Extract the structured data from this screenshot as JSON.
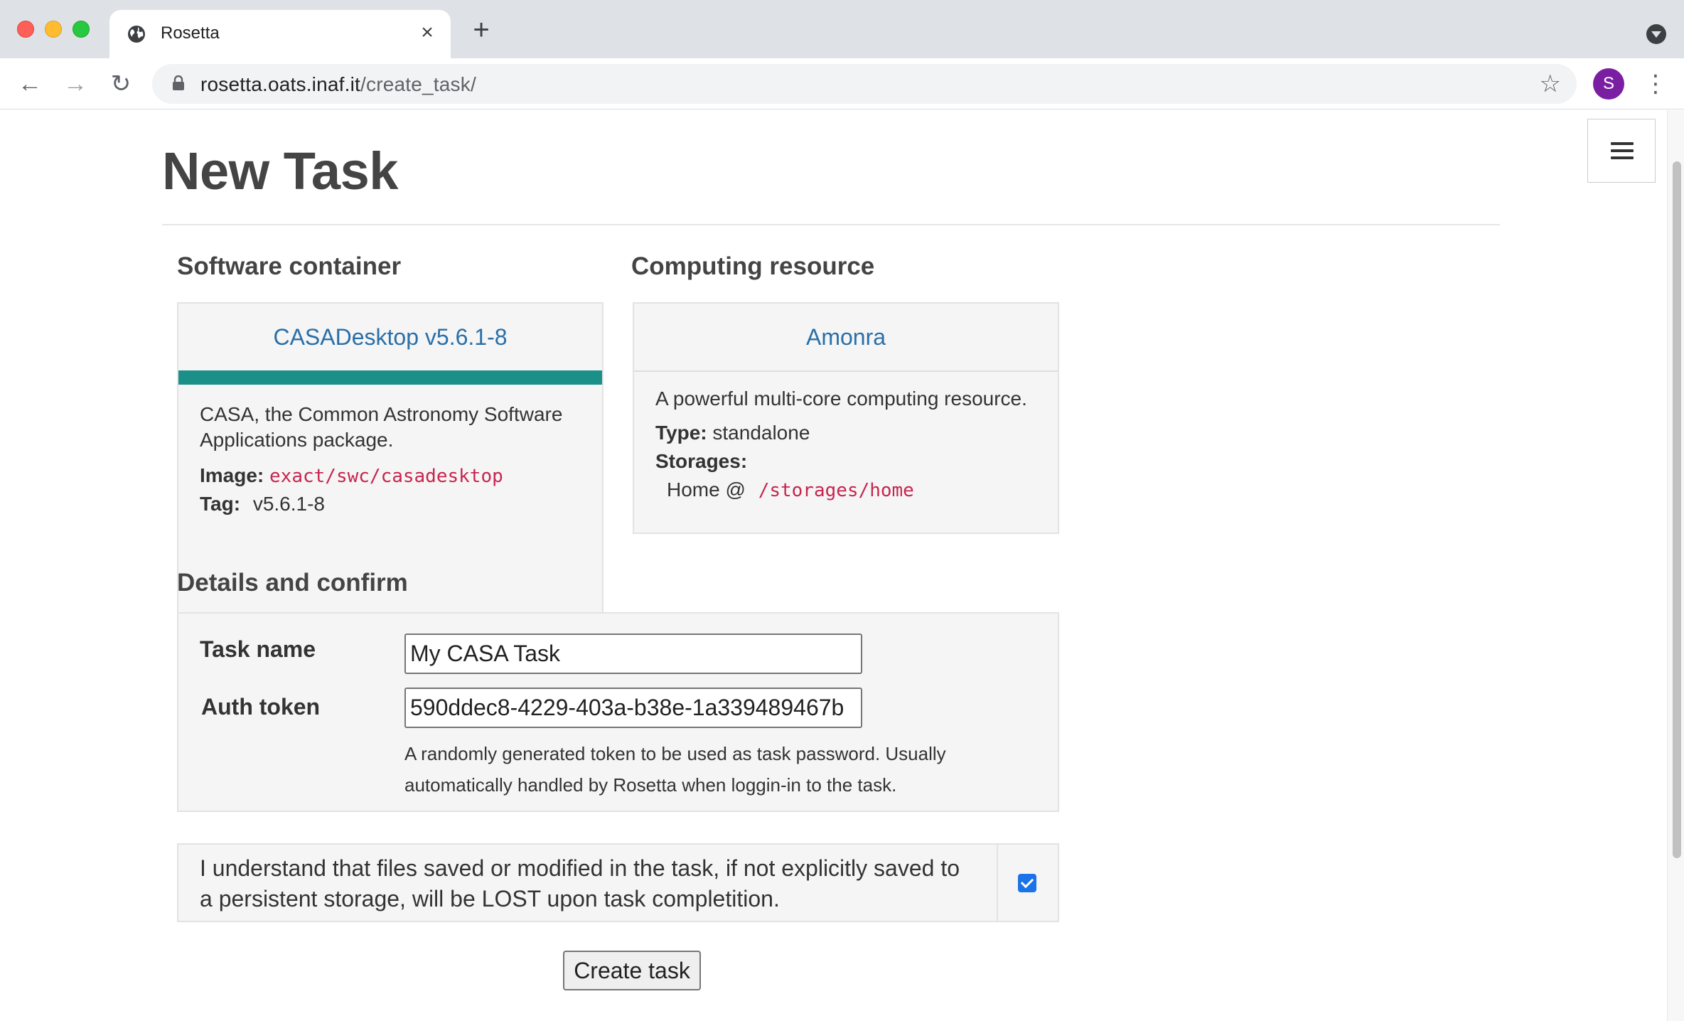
{
  "browser": {
    "tab_title": "Rosetta",
    "url_host": "rosetta.oats.inaf.it",
    "url_path": "/create_task/",
    "profile_initial": "S"
  },
  "page": {
    "title": "New Task"
  },
  "software": {
    "heading": "Software container",
    "name": "CASADesktop v5.6.1-8",
    "description": "CASA, the Common Astronomy Software Applications package.",
    "image_label": "Image:",
    "image_value": "exact/swc/casadesktop",
    "tag_label": "Tag:",
    "tag_value": "v5.6.1-8",
    "accent_color": "#1a9088"
  },
  "computing": {
    "heading": "Computing resource",
    "name": "Amonra",
    "description": "A powerful multi-core computing resource.",
    "type_label": "Type:",
    "type_value": "standalone",
    "storages_label": "Storages:",
    "storage_name": "Home @",
    "storage_path": "/storages/home"
  },
  "details": {
    "heading": "Details and confirm",
    "task_name_label": "Task name",
    "task_name_value": "My CASA Task",
    "auth_token_label": "Auth token",
    "auth_token_value": "590ddec8-4229-403a-b38e-1a339489467b",
    "auth_token_help": "A randomly generated token to be used as task password. Usually automatically handled by Rosetta when loggin-in to the task."
  },
  "confirm": {
    "text": "I understand that files saved or modified in the task, if not explicitly saved to a persistent storage, will be LOST upon task completition.",
    "checked": true
  },
  "actions": {
    "create_label": "Create task"
  }
}
